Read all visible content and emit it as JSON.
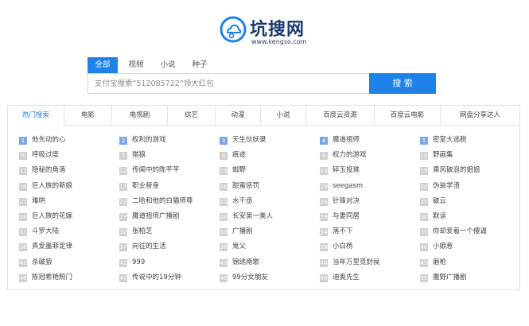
{
  "logo": {
    "title": "坑搜网",
    "url": "www.kengso.com"
  },
  "search_tabs": [
    {
      "label": "全部",
      "active": true
    },
    {
      "label": "视频",
      "active": false
    },
    {
      "label": "小说",
      "active": false
    },
    {
      "label": "种子",
      "active": false
    }
  ],
  "search": {
    "placeholder": "支付宝搜索“512085722”领大红包",
    "button": "搜 索"
  },
  "accent_color": "#1f82e8",
  "hot_tabs": [
    {
      "label": "热门搜索",
      "active": true
    },
    {
      "label": "电影",
      "active": false
    },
    {
      "label": "电视剧",
      "active": false
    },
    {
      "label": "综艺",
      "active": false
    },
    {
      "label": "动漫",
      "active": false
    },
    {
      "label": "小说",
      "active": false
    },
    {
      "label": "百度云资源",
      "active": false
    },
    {
      "label": "百度云电影",
      "active": false
    },
    {
      "label": "网盘分享达人",
      "active": false
    }
  ],
  "hot_list": [
    {
      "rank": "1",
      "title": "他先动的心"
    },
    {
      "rank": "2",
      "title": "权利的游戏"
    },
    {
      "rank": "3",
      "title": "天生伙妖录"
    },
    {
      "rank": "4",
      "title": "魔道祖师"
    },
    {
      "rank": "5",
      "title": "密室大逃脱"
    },
    {
      "rank": "6",
      "title": "呼吸过度"
    },
    {
      "rank": "7",
      "title": "猎狼"
    },
    {
      "rank": "8",
      "title": "痕迹"
    },
    {
      "rank": "9",
      "title": "权力的游戏"
    },
    {
      "rank": "10",
      "title": "野画集"
    },
    {
      "rank": "11",
      "title": "隐秘的角落"
    },
    {
      "rank": "12",
      "title": "传闻中的陈芊芊"
    },
    {
      "rank": "13",
      "title": "蜘野"
    },
    {
      "rank": "14",
      "title": "碎玉投珠"
    },
    {
      "rank": "15",
      "title": "乘风破浪的姐姐"
    },
    {
      "rank": "16",
      "title": "巨人族的新娘"
    },
    {
      "rank": "17",
      "title": "职业替身"
    },
    {
      "rank": "18",
      "title": "甜蜜惩罚"
    },
    {
      "rank": "19",
      "title": "seegasm"
    },
    {
      "rank": "20",
      "title": "伪装学渣"
    },
    {
      "rank": "21",
      "title": "难哄"
    },
    {
      "rank": "22",
      "title": "二哈和他的白猫师尊"
    },
    {
      "rank": "23",
      "title": "水千丞"
    },
    {
      "rank": "24",
      "title": "针锋对决"
    },
    {
      "rank": "25",
      "title": "破云"
    },
    {
      "rank": "26",
      "title": "巨人族的花嫁"
    },
    {
      "rank": "27",
      "title": "魔道祖师广播剧"
    },
    {
      "rank": "28",
      "title": "长安第一美人"
    },
    {
      "rank": "29",
      "title": "与妻同居"
    },
    {
      "rank": "30",
      "title": "默读"
    },
    {
      "rank": "31",
      "title": "斗罗大陆"
    },
    {
      "rank": "32",
      "title": "张柏芝"
    },
    {
      "rank": "33",
      "title": "广播剧"
    },
    {
      "rank": "34",
      "title": "落不下"
    },
    {
      "rank": "35",
      "title": "你却爱着一个傻逼"
    },
    {
      "rank": "36",
      "title": "真爱墨菲定律"
    },
    {
      "rank": "37",
      "title": "向往的生活"
    },
    {
      "rank": "38",
      "title": "鬼父"
    },
    {
      "rank": "39",
      "title": "小白杨"
    },
    {
      "rank": "40",
      "title": "小娘惹"
    },
    {
      "rank": "41",
      "title": "杀破狼"
    },
    {
      "rank": "42",
      "title": "999"
    },
    {
      "rank": "43",
      "title": "锦绣南歌"
    },
    {
      "rank": "44",
      "title": "当年万里觅封侯"
    },
    {
      "rank": "45",
      "title": "磨枪"
    },
    {
      "rank": "46",
      "title": "陈冠希艳照门"
    },
    {
      "rank": "47",
      "title": "传说中的19分钟"
    },
    {
      "rank": "48",
      "title": "99分女朋友"
    },
    {
      "rank": "49",
      "title": "迪奥先生"
    },
    {
      "rank": "50",
      "title": "撒野广播剧"
    }
  ]
}
